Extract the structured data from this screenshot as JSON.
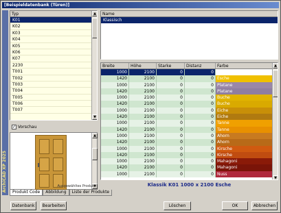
{
  "window": {
    "title": "[Beispieldatenbank (Türen)]",
    "side_label": "ArchiCAD XP 2025"
  },
  "typ_list": {
    "header": "Typ",
    "items": [
      "K01",
      "K02",
      "K03",
      "K04",
      "K05",
      "K06",
      "K07",
      "2230",
      "T001",
      "T002",
      "T003",
      "T004",
      "T005",
      "T006",
      "T007"
    ],
    "selected_index": 0
  },
  "vorschau": {
    "label": "Vorschau",
    "checked": true
  },
  "preview": {
    "label": "Ausgewähltes Produkt"
  },
  "name_box": {
    "header": "Name",
    "value": "Klassisch"
  },
  "grid": {
    "headers": [
      "Breite",
      "Höhe",
      "Starke",
      "Distanz",
      "Farbe"
    ],
    "rows": [
      {
        "breite": "1000",
        "hoehe": "2100",
        "starke": "0",
        "distanz": "0",
        "farbe": "Esche",
        "color": "#ffffff"
      },
      {
        "breite": "1420",
        "hoehe": "2100",
        "starke": "0",
        "distanz": "0",
        "farbe": "Esche",
        "color": "#f0c000"
      },
      {
        "breite": "1000",
        "hoehe": "2100",
        "starke": "0",
        "distanz": "0",
        "farbe": "Platane",
        "color": "#9a87a8"
      },
      {
        "breite": "1420",
        "hoehe": "2100",
        "starke": "0",
        "distanz": "0",
        "farbe": "Platane",
        "color": "#8f7ea0"
      },
      {
        "breite": "1000",
        "hoehe": "2100",
        "starke": "0",
        "distanz": "0",
        "farbe": "Buche",
        "color": "#e0b400"
      },
      {
        "breite": "1420",
        "hoehe": "2100",
        "starke": "0",
        "distanz": "0",
        "farbe": "Buche",
        "color": "#d9aa00"
      },
      {
        "breite": "1000",
        "hoehe": "2100",
        "starke": "0",
        "distanz": "0",
        "farbe": "Eiche",
        "color": "#c88f08"
      },
      {
        "breite": "1420",
        "hoehe": "2100",
        "starke": "0",
        "distanz": "0",
        "farbe": "Eiche",
        "color": "#b07a10"
      },
      {
        "breite": "1000",
        "hoehe": "2100",
        "starke": "0",
        "distanz": "0",
        "farbe": "Tanne",
        "color": "#f0a000"
      },
      {
        "breite": "1420",
        "hoehe": "2100",
        "starke": "0",
        "distanz": "0",
        "farbe": "Tanne",
        "color": "#e89000"
      },
      {
        "breite": "1000",
        "hoehe": "2100",
        "starke": "0",
        "distanz": "0",
        "farbe": "Ahorn",
        "color": "#c87a20"
      },
      {
        "breite": "1420",
        "hoehe": "2100",
        "starke": "0",
        "distanz": "0",
        "farbe": "Ahorn",
        "color": "#b86a18"
      },
      {
        "breite": "1000",
        "hoehe": "2100",
        "starke": "0",
        "distanz": "0",
        "farbe": "Kirsche",
        "color": "#d05a10"
      },
      {
        "breite": "1420",
        "hoehe": "2100",
        "starke": "0",
        "distanz": "0",
        "farbe": "Kirsche",
        "color": "#c04c10"
      },
      {
        "breite": "1000",
        "hoehe": "2100",
        "starke": "0",
        "distanz": "0",
        "farbe": "Mahagoni",
        "color": "#8a1a08"
      },
      {
        "breite": "1420",
        "hoehe": "2100",
        "starke": "0",
        "distanz": "0",
        "farbe": "Mahagoni",
        "color": "#7a1408"
      },
      {
        "breite": "1000",
        "hoehe": "2100",
        "starke": "0",
        "distanz": "0",
        "farbe": "Nuss",
        "color": "#b0283c"
      }
    ]
  },
  "caption": "Klassik K01 1000 x 2100 Esche",
  "tabs": [
    "Produkt Code",
    "Abbildung",
    "Liste der Produkte"
  ],
  "buttons": {
    "datenbank": "Datenbank",
    "bearbeiten": "Bearbeiten",
    "loeschen": "Löschen",
    "ok": "OK",
    "abbrechen": "Abbrechen"
  }
}
